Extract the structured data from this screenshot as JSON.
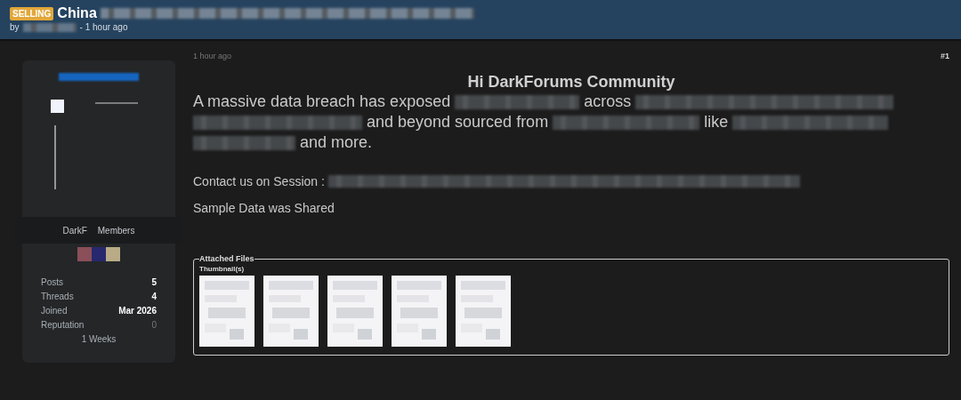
{
  "thread": {
    "badge": "SELLING",
    "title": "China",
    "byline_prefix": "by",
    "byline_time": "- 1 hour ago"
  },
  "user": {
    "group_parts": [
      "DarkF",
      "Members"
    ],
    "group_icons": [
      {
        "color": "#8a4f58"
      },
      {
        "color": "#27286e"
      },
      {
        "color": "#b9ab86"
      }
    ],
    "stats": [
      {
        "label": "Posts",
        "value": "5",
        "kind": "bold"
      },
      {
        "label": "Threads",
        "value": "4",
        "kind": "bold"
      },
      {
        "label": "Joined",
        "value": "Mar 2026",
        "kind": "bold"
      },
      {
        "label": "Reputation",
        "value": "0",
        "kind": "muted"
      }
    ],
    "age": "1 Weeks"
  },
  "post": {
    "time": "1 hour ago",
    "number": "#1",
    "heading": "Hi DarkForums Community",
    "body": [
      {
        "kind": "text",
        "text": "A massive data breach has exposed"
      },
      {
        "kind": "redacted"
      },
      {
        "kind": "text",
        "text": "across"
      },
      {
        "kind": "redacted"
      },
      {
        "kind": "redacted"
      },
      {
        "kind": "text",
        "text": "and beyond sourced from"
      },
      {
        "kind": "redacted"
      },
      {
        "kind": "text",
        "text": "like"
      },
      {
        "kind": "redacted"
      },
      {
        "kind": "redacted"
      },
      {
        "kind": "text",
        "text": "and more."
      }
    ],
    "contact": "Contact us on Session :",
    "sample": "Sample Data was Shared",
    "attachments": {
      "legend": "Attached Files",
      "thumbs_label": "Thumbnail(s)"
    }
  }
}
